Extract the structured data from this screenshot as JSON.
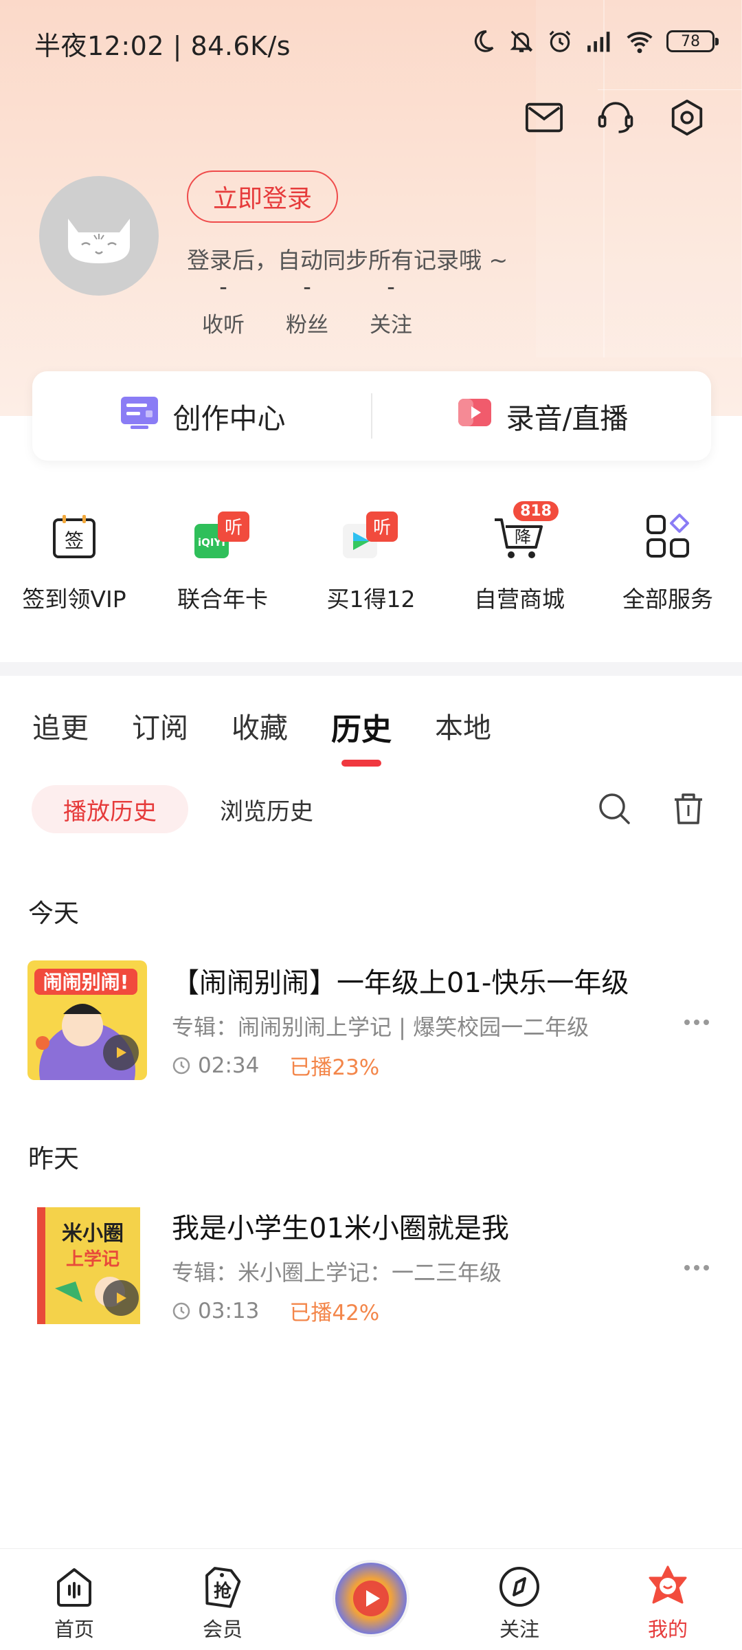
{
  "status_bar": {
    "time_and_speed": "半夜12:02 | 84.6K/s",
    "battery": "78"
  },
  "profile": {
    "login_button": "立即登录",
    "login_hint": "登录后，自动同步所有记录哦 ~",
    "stats": [
      {
        "value": "-",
        "label": "收听"
      },
      {
        "value": "-",
        "label": "粉丝"
      },
      {
        "value": "-",
        "label": "关注"
      }
    ]
  },
  "create_card": {
    "creation_center": "创作中心",
    "record_live": "录音/直播"
  },
  "services": [
    {
      "label": "签到领VIP",
      "icon": "sign-in-icon"
    },
    {
      "label": "联合年卡",
      "icon": "iqiyi-annual-card-icon"
    },
    {
      "label": "买1得12",
      "icon": "buy-one-get-twelve-icon"
    },
    {
      "label": "自营商城",
      "icon": "shopping-cart-icon",
      "badge": "818"
    },
    {
      "label": "全部服务",
      "icon": "all-services-icon"
    }
  ],
  "tabs": [
    "追更",
    "订阅",
    "收藏",
    "历史",
    "本地"
  ],
  "active_tab": "历史",
  "subtabs": [
    "播放历史",
    "浏览历史"
  ],
  "history": [
    {
      "day": "今天",
      "title": "【闹闹别闹】一年级上01-快乐一年级",
      "album": "专辑：闹闹别闹上学记 | 爆笑校园一二年级",
      "duration": "02:34",
      "progress": "已播23%"
    },
    {
      "day": "昨天",
      "title": "我是小学生01米小圈就是我",
      "album": "专辑：米小圈上学记：一二三年级",
      "duration": "03:13",
      "progress": "已播42%"
    }
  ],
  "bottom_nav": [
    {
      "label": "首页",
      "icon": "home-icon"
    },
    {
      "label": "会员",
      "icon": "vip-grab-icon"
    },
    {
      "label": "",
      "icon": "now-playing-disc"
    },
    {
      "label": "关注",
      "icon": "compass-icon"
    },
    {
      "label": "我的",
      "icon": "mine-icon"
    }
  ],
  "colors": {
    "accent": "#e63b3b",
    "progress": "#f3864a"
  }
}
